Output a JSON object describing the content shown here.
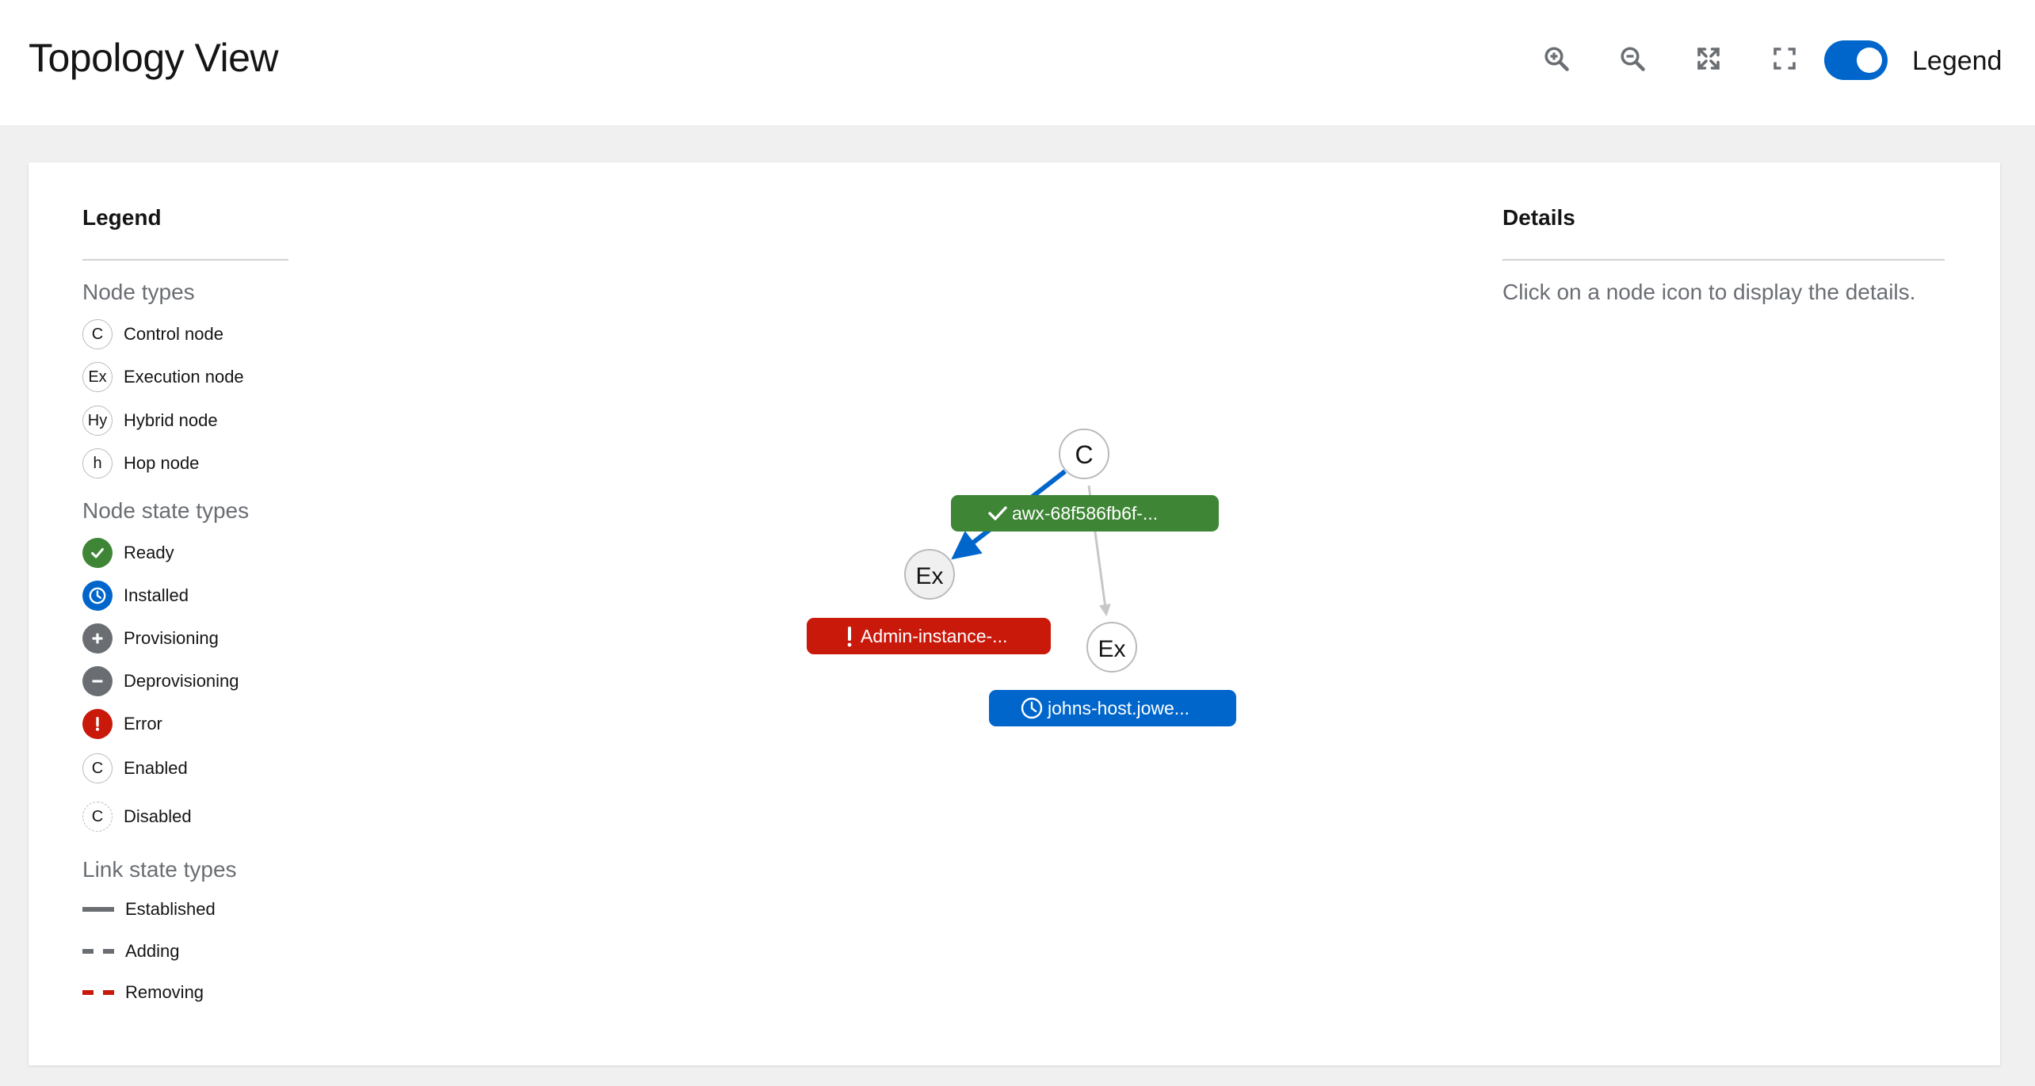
{
  "header": {
    "title": "Topology View",
    "toolbar": {
      "zoom_in_icon": "zoom-in-icon",
      "zoom_out_icon": "zoom-out-icon",
      "fit_icon": "fit-to-screen-icon",
      "reset_icon": "expand-icon",
      "legend_toggle_on": true,
      "legend_label": "Legend"
    }
  },
  "legend": {
    "title": "Legend",
    "node_types_title": "Node types",
    "node_types": [
      {
        "badge": "C",
        "label": "Control node"
      },
      {
        "badge": "Ex",
        "label": "Execution node"
      },
      {
        "badge": "Hy",
        "label": "Hybrid node"
      },
      {
        "badge": "h",
        "label": "Hop node"
      }
    ],
    "node_state_title": "Node state types",
    "node_states": [
      {
        "label": "Ready",
        "color": "#3e8635",
        "icon": "check-icon"
      },
      {
        "label": "Installed",
        "color": "#0066cc",
        "icon": "clock-icon"
      },
      {
        "label": "Provisioning",
        "color": "#6a6e73",
        "icon": "plus-icon"
      },
      {
        "label": "Deprovisioning",
        "color": "#6a6e73",
        "icon": "minus-icon"
      },
      {
        "label": "Error",
        "color": "#c9190b",
        "icon": "exclamation-icon"
      },
      {
        "label": "Enabled",
        "badge": "C"
      },
      {
        "label": "Disabled",
        "badge": "C"
      }
    ],
    "link_state_title": "Link state types",
    "link_states": [
      {
        "label": "Established",
        "color": "#6a6e73",
        "style": "solid"
      },
      {
        "label": "Adding",
        "color": "#6a6e73",
        "style": "dashed"
      },
      {
        "label": "Removing",
        "color": "#c9190b",
        "style": "dashed"
      }
    ]
  },
  "details": {
    "title": "Details",
    "help": "Click on a node icon to display the details."
  },
  "graph": {
    "nodes": [
      {
        "id": "control",
        "badge": "C",
        "label": "awx-68f586fb6f-...",
        "state": "ready",
        "color": "#3e8635"
      },
      {
        "id": "exec-admin",
        "badge": "Ex",
        "label": "Admin-instance-...",
        "state": "error",
        "color": "#c9190b",
        "selected": true
      },
      {
        "id": "exec-johns",
        "badge": "Ex",
        "label": "johns-host.jowe...",
        "state": "installed",
        "color": "#0066cc"
      }
    ],
    "links": [
      {
        "source": "control",
        "target": "exec-admin",
        "color": "#0066cc",
        "highlighted": true
      },
      {
        "source": "control",
        "target": "exec-johns",
        "color": "#c7c7c7",
        "highlighted": false
      }
    ]
  }
}
